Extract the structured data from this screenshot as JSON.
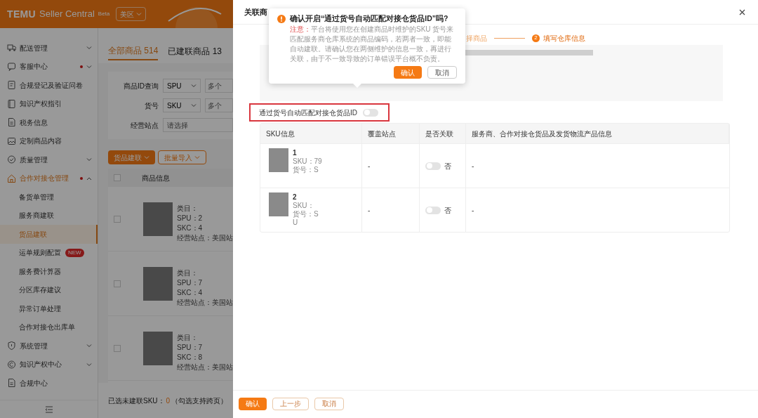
{
  "header": {
    "logo": "TEMU",
    "product": "Seller Central",
    "beta": "Beta",
    "region": "美区"
  },
  "sidebar": {
    "items": [
      {
        "label": "配送管理",
        "dot": false,
        "expanded": false,
        "selected": false
      },
      {
        "label": "客服中心",
        "dot": true,
        "expanded": false,
        "selected": false
      },
      {
        "label": "合规登记及验证问卷",
        "dot": false,
        "selected": false
      },
      {
        "label": "知识产权指引",
        "dot": false,
        "selected": false
      },
      {
        "label": "税务信息",
        "dot": false,
        "selected": false
      },
      {
        "label": "定制商品内容",
        "dot": false,
        "selected": false
      },
      {
        "label": "质量管理",
        "dot": false,
        "expanded": false,
        "selected": false
      },
      {
        "label": "合作对接仓管理",
        "dot": true,
        "expanded": true,
        "selected": true,
        "children": [
          {
            "label": "备货单管理",
            "selected": false
          },
          {
            "label": "服务商建联",
            "selected": false
          },
          {
            "label": "货品建联",
            "selected": true
          },
          {
            "label": "运单规则配置",
            "badge": "NEW",
            "selected": false
          },
          {
            "label": "服务费计算器",
            "selected": false
          },
          {
            "label": "分区库存建议",
            "selected": false
          },
          {
            "label": "异常订单处理",
            "selected": false
          },
          {
            "label": "合作对接仓出库单",
            "selected": false
          }
        ]
      },
      {
        "label": "系统管理",
        "dot": false,
        "expanded": false,
        "selected": false
      },
      {
        "label": "知识产权中心",
        "dot": false,
        "expanded": false,
        "selected": false
      },
      {
        "label": "合规中心",
        "dot": false,
        "selected": false
      }
    ]
  },
  "page": {
    "tabs": [
      {
        "label": "全部商品 514",
        "selected": true
      },
      {
        "label": "已建联商品 13",
        "selected": false
      }
    ],
    "filters": [
      {
        "label": "商品ID查询",
        "select": "SPU",
        "input": "多个"
      },
      {
        "label": "货号",
        "select": "SKU",
        "input": "多个"
      },
      {
        "label": "经营站点",
        "placeholder": "请选择"
      }
    ],
    "buttons": [
      {
        "label": "货品建联",
        "kind": "primary"
      },
      {
        "label": "批量导入",
        "kind": "outline"
      }
    ],
    "table": {
      "column": "商品信息",
      "all_checked": false,
      "rows": [
        {
          "checked": false,
          "lines": [
            "类目：",
            "SPU：2",
            "SKC：4"
          ],
          "site": "经营站点：美国站"
        },
        {
          "checked": false,
          "lines": [
            "类目：",
            "SPU：7",
            "SKC：4"
          ],
          "site": "经营站点：美国站"
        },
        {
          "checked": false,
          "lines": [
            "类目：",
            "SPU：7",
            "SKC：8"
          ],
          "site": "经营站点：美国站"
        }
      ]
    },
    "footer": {
      "label": "已选未建联SKU：",
      "count": "0",
      "hint": "（勾选支持跨页）"
    }
  },
  "drawer": {
    "title": "关联商",
    "steps": [
      {
        "label": "择商品",
        "active": false
      },
      {
        "number": "2",
        "label": "填写仓库信息",
        "active": true
      }
    ],
    "auto_match": {
      "label": "通过货号自动匹配对接仓货品ID",
      "on": false
    },
    "table": {
      "columns": [
        "SKU信息",
        "覆盖站点",
        "是否关联",
        "服务商、合作对接仓货品及发货物流产品信息"
      ],
      "rows": [
        {
          "name": "1",
          "lines": [
            "SKU：79",
            "货号：S"
          ],
          "site": "-",
          "linked": false,
          "linked_label": "否",
          "info": "-"
        },
        {
          "name": "2",
          "lines": [
            "SKU：",
            "货号：S",
            "U"
          ],
          "site": "-",
          "linked": false,
          "linked_label": "否",
          "info": "-"
        }
      ]
    },
    "buttons": [
      {
        "label": "确认",
        "kind": "primary"
      },
      {
        "label": "上一步",
        "kind": "outline"
      },
      {
        "label": "取消",
        "kind": "outline"
      }
    ]
  },
  "popconfirm": {
    "title": "确认开启“通过货号自动匹配对接仓货品ID”吗?",
    "note_label": "注意：",
    "note": "平台将使用您在创建商品时维护的SKU 货号来匹配服务商仓库系统的商品编码，若两者一致，即能自动建联。请确认您在两侧维护的信息一致，再进行关联，由于不一致导致的订单错误平台概不负责。",
    "buttons": [
      {
        "label": "确认",
        "kind": "primary"
      },
      {
        "label": "取消",
        "kind": "outline"
      }
    ]
  }
}
